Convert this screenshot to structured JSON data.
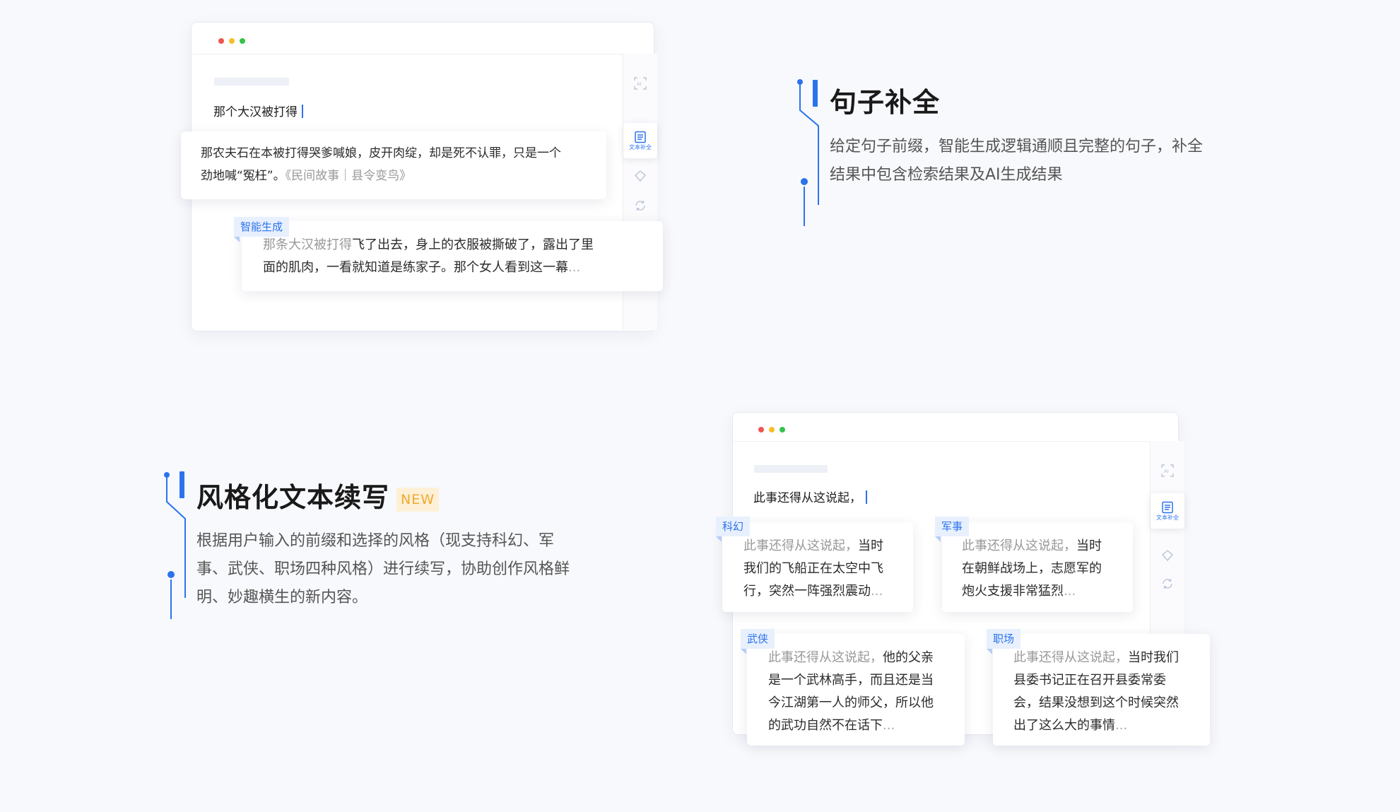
{
  "feature1": {
    "title": "句子补全",
    "description_line1": "给定句子前缀，智能生成逻辑通顺且完整的句子，补全",
    "description_line2": "结果中包含检索结果及AI生成结果"
  },
  "feature2": {
    "title": "风格化文本续写",
    "badge": "NEW",
    "description_line1": "根据用户输入的前缀和选择的风格（现支持科幻、军",
    "description_line2": "事、武侠、职场四种风格）进行续写，协助创作风格鲜",
    "description_line3": "明、妙趣横生的新内容。"
  },
  "window1": {
    "prompt": "那个大汉被打得",
    "tool_active_label": "文本补全",
    "search_result": {
      "line1": "那农夫石在本被打得哭爹喊娘，皮开肉绽，却是死不认罪，只是一个",
      "line2": "劲地喊“冤枉”。",
      "source": "《民间故事｜县令变鸟》"
    },
    "ai_result": {
      "tag": "智能生成",
      "prefix": "那条大汉被打得",
      "line1_rest": "飞了出去，身上的衣服被撕破了，露出了里",
      "line2": "面的肌肉，一看就知道是练家子。那个女人看到这一幕",
      "ellipsis": "..."
    }
  },
  "window2": {
    "prompt": "此事还得从这说起，",
    "tool_active_label": "文本补全",
    "cards": [
      {
        "tag": "科幻",
        "prefix": "此事还得从这说起，",
        "line1_rest": "当时",
        "line2": "我们的飞船正在太空中飞",
        "line3": "行，突然一阵强烈震动",
        "ellipsis": "..."
      },
      {
        "tag": "军事",
        "prefix": "此事还得从这说起，",
        "line1_rest": "当时",
        "line2": "在朝鲜战场上，志愿军的",
        "line3": "炮火支援非常猛烈",
        "ellipsis": "..."
      },
      {
        "tag": "武侠",
        "prefix": "此事还得从这说起，",
        "line1_rest": "他的父亲",
        "line2": "是一个武林高手，而且还是当",
        "line3": "今江湖第一人的师父，所以他",
        "line4": "的武功自然不在话下",
        "ellipsis": "..."
      },
      {
        "tag": "职场",
        "prefix": "此事还得从这说起，",
        "line1_rest": "当时我们",
        "line2": "县委书记正在召开县委常委",
        "line3": "会，结果没想到这个时候突然",
        "line4": "出了这么大的事情",
        "ellipsis": "..."
      }
    ]
  },
  "colors": {
    "accent": "#2b73ee",
    "badge_bg": "#fdf0d6",
    "badge_text": "#f0a92e"
  },
  "icons": [
    "scan-text-icon",
    "document-icon",
    "tag-icon",
    "refresh-icon",
    "timeline-connector-icon"
  ]
}
